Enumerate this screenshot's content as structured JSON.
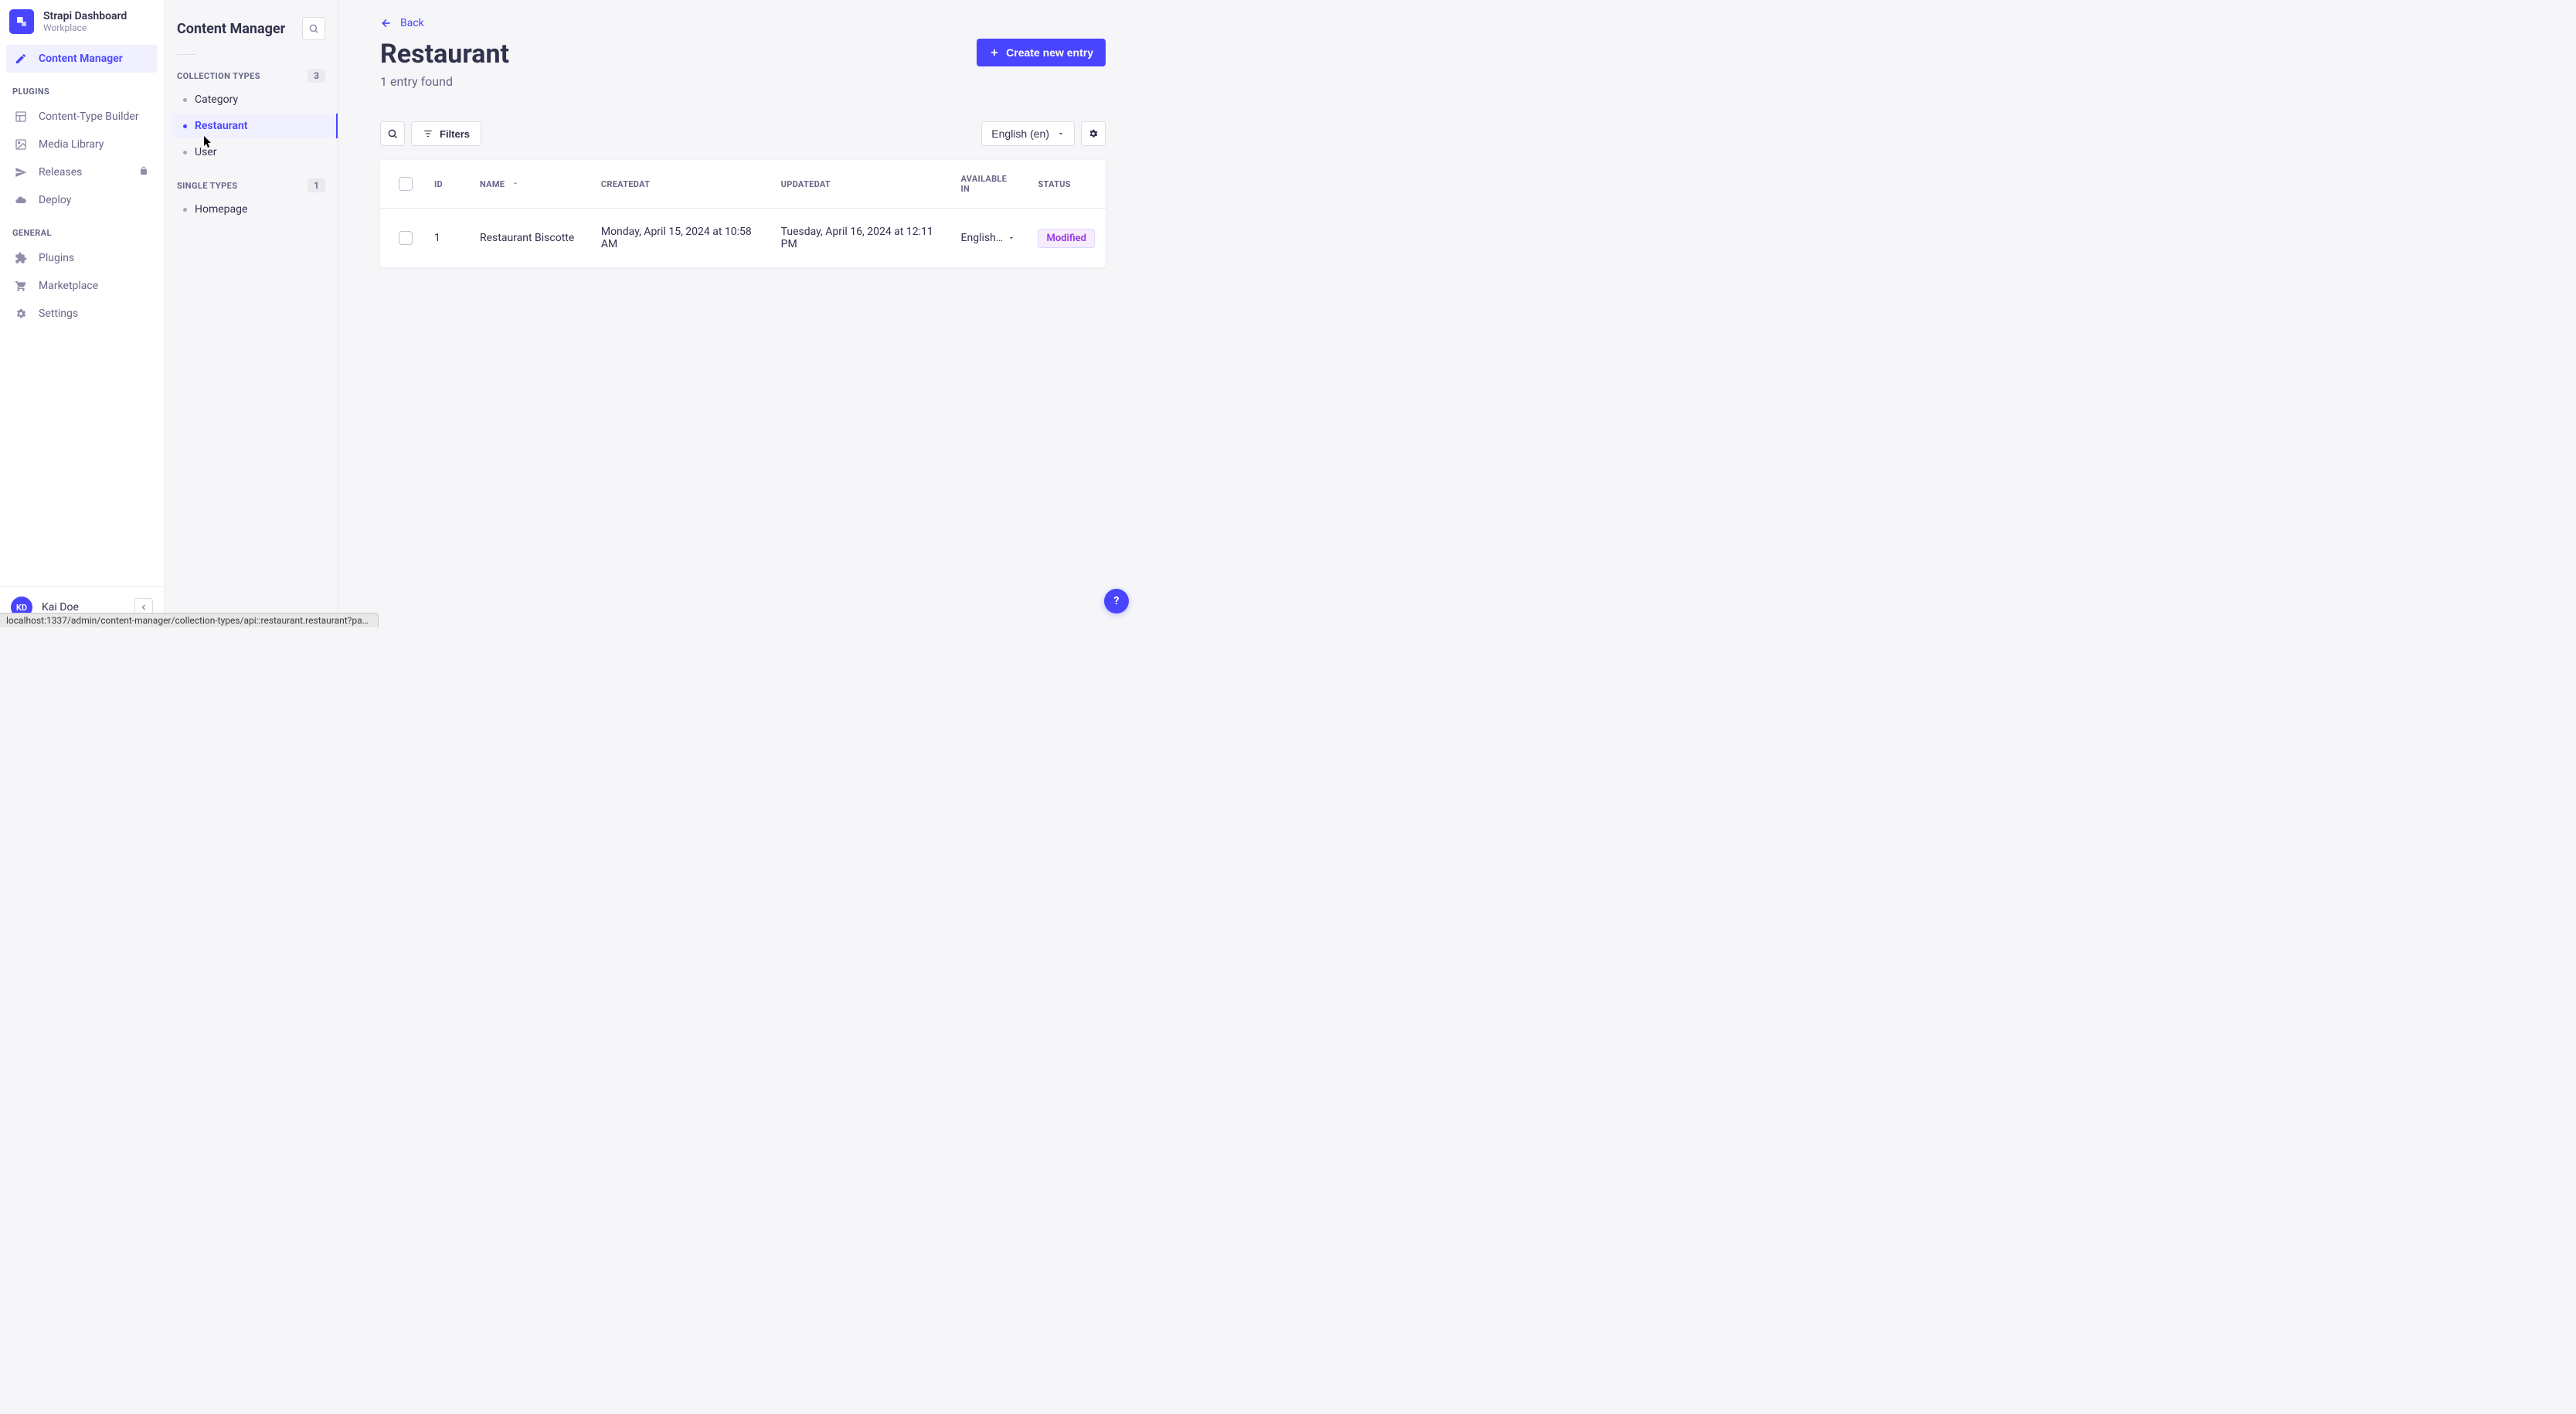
{
  "brand": {
    "title": "Strapi Dashboard",
    "subtitle": "Workplace"
  },
  "nav": {
    "contentManager": "Content Manager",
    "pluginsHeading": "PLUGINS",
    "generalHeading": "GENERAL",
    "contentTypeBuilder": "Content-Type Builder",
    "mediaLibrary": "Media Library",
    "releases": "Releases",
    "deploy": "Deploy",
    "plugins": "Plugins",
    "marketplace": "Marketplace",
    "settings": "Settings"
  },
  "user": {
    "initials": "KD",
    "name": "Kai Doe"
  },
  "subSidebar": {
    "title": "Content Manager",
    "collectionTypesLabel": "COLLECTION TYPES",
    "collectionTypesCount": "3",
    "singleTypesLabel": "SINGLE TYPES",
    "singleTypesCount": "1",
    "collectionTypes": {
      "category": "Category",
      "restaurant": "Restaurant",
      "user": "User"
    },
    "singleTypes": {
      "homepage": "Homepage"
    }
  },
  "main": {
    "backLabel": "Back",
    "title": "Restaurant",
    "subtitle": "1 entry found",
    "createBtn": "Create new entry",
    "filtersBtn": "Filters",
    "localeBtn": "English (en)"
  },
  "table": {
    "headers": {
      "id": "ID",
      "name": "NAME",
      "createdat": "CREATEDAT",
      "updatedat": "UPDATEDAT",
      "availablein": "AVAILABLE IN",
      "status": "STATUS"
    },
    "rows": [
      {
        "id": "1",
        "name": "Restaurant Biscotte",
        "createdat": "Monday, April 15, 2024 at 10:58 AM",
        "updatedat": "Tuesday, April 16, 2024 at 12:11 PM",
        "availablein": "English…",
        "status": "Modified"
      }
    ]
  },
  "urlHover": "localhost:1337/admin/content-manager/collection-types/api::restaurant.restaurant?page=1&pa…",
  "helpFab": "?"
}
